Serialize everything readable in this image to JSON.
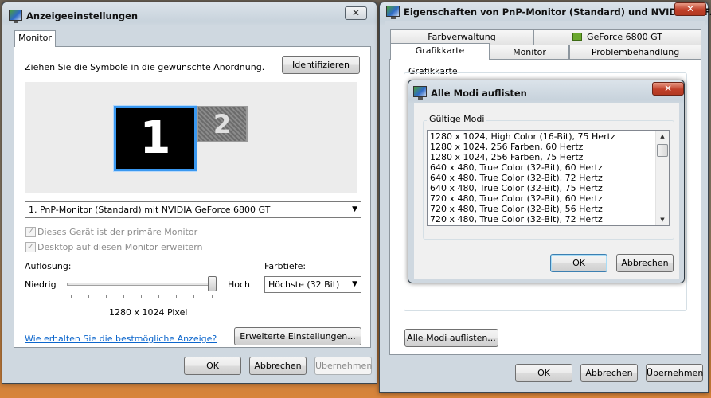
{
  "left_window": {
    "title": "Anzeigeeinstellungen",
    "close_label": "✕",
    "tab_label": "Monitor",
    "instruction": "Ziehen Sie die Symbole in die gewünschte Anordnung.",
    "identify_button": "Identifizieren",
    "monitor1_number": "1",
    "monitor2_number": "2",
    "monitor_select": "1. PnP-Monitor (Standard) mit NVIDIA GeForce 6800 GT",
    "checkbox_primary": "Dieses Gerät ist der primäre Monitor",
    "checkbox_extend": "Desktop auf diesen Monitor erweitern",
    "resolution_label": "Auflösung:",
    "low_label": "Niedrig",
    "high_label": "Hoch",
    "resolution_value": "1280 x 1024 Pixel",
    "resolution_slider_position": 1.0,
    "color_depth_label": "Farbtiefe:",
    "color_depth_value": "Höchste (32 Bit)",
    "help_link": "Wie erhalten Sie die bestmögliche Anzeige?",
    "advanced_button": "Erweiterte Einstellungen...",
    "ok_button": "OK",
    "cancel_button": "Abbrechen",
    "apply_button": "Übernehmen"
  },
  "right_window": {
    "title": "Eigenschaften von PnP-Monitor (Standard) und NVIDIA GeF...",
    "close_label": "✕",
    "tabs_row_top": [
      "Farbverwaltung",
      "GeForce 6800 GT"
    ],
    "tabs_row_bottom": [
      "Grafikkarte",
      "Monitor",
      "Problembehandlung"
    ],
    "active_tab": "Grafikkarte",
    "group_label": "Grafikkarte",
    "list_all_modes_button": "Alle Modi auflisten...",
    "ok_button": "OK",
    "cancel_button": "Abbrechen",
    "apply_button": "Übernehmen"
  },
  "modes_dialog": {
    "title": "Alle Modi auflisten",
    "close_label": "✕",
    "group_label": "Gültige Modi",
    "modes": [
      "1280 x 1024, High Color (16-Bit), 75 Hertz",
      "1280 x 1024, 256 Farben, 60 Hertz",
      "1280 x 1024, 256 Farben, 75 Hertz",
      "640 x 480, True Color (32-Bit), 60 Hertz",
      "640 x 480, True Color (32-Bit), 72 Hertz",
      "640 x 480, True Color (32-Bit), 75 Hertz",
      "720 x 480, True Color (32-Bit), 60 Hertz",
      "720 x 480, True Color (32-Bit), 56 Hertz",
      "720 x 480, True Color (32-Bit), 72 Hertz"
    ],
    "ok_button": "OK",
    "cancel_button": "Abbrechen"
  }
}
